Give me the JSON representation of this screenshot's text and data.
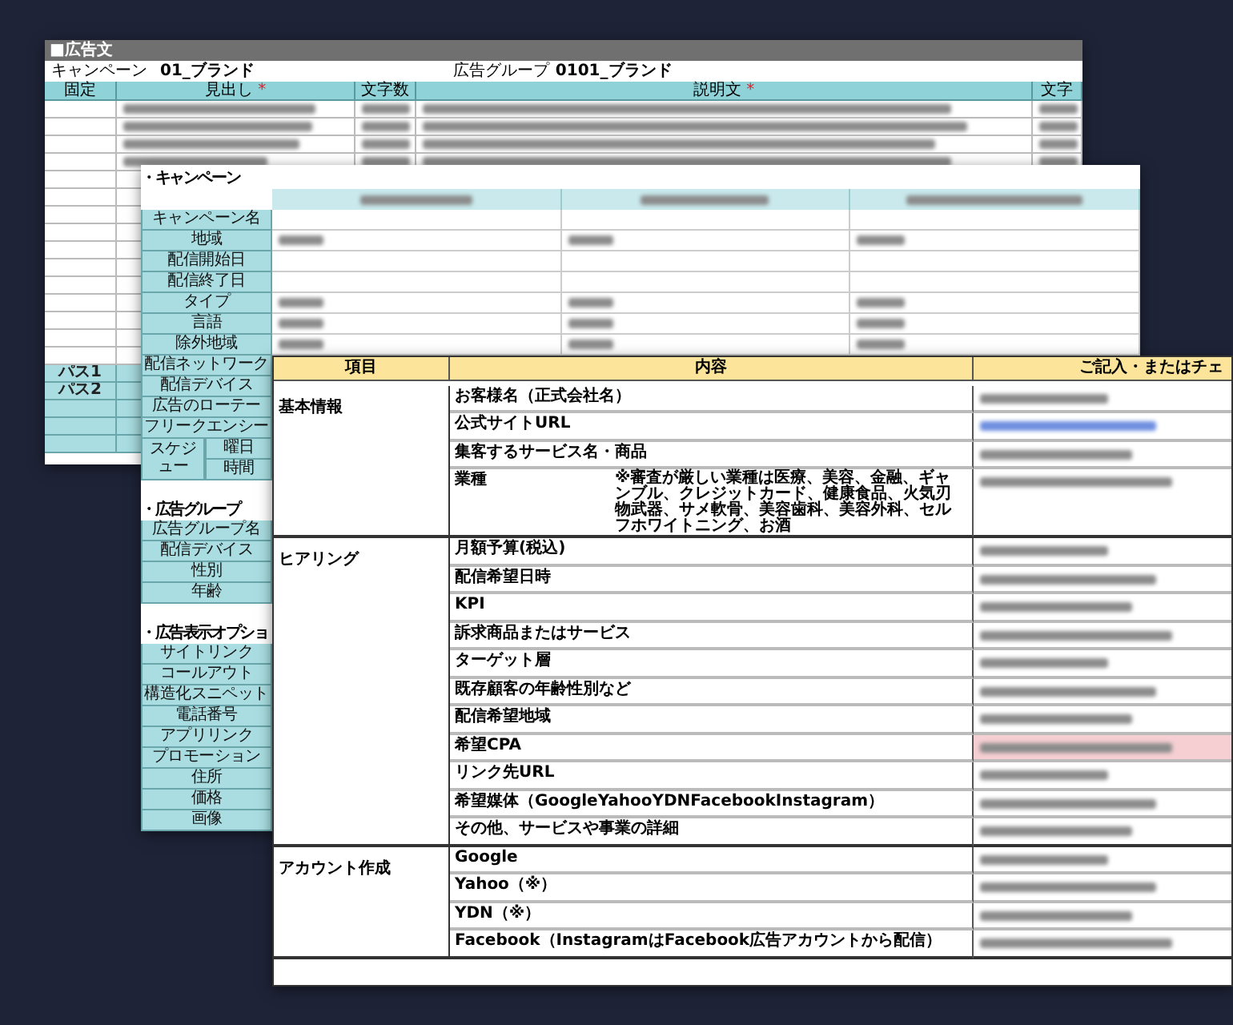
{
  "ad_sheet": {
    "title": "■広告文",
    "campaign_label": "キャンペーン",
    "campaign": "01_ブランド",
    "group_label": "広告グループ",
    "group": "0101_ブランド",
    "required_mark": "*",
    "columns": [
      {
        "label": "固定",
        "required": false
      },
      {
        "label": "見出し",
        "required": true
      },
      {
        "label": "文字数",
        "required": false
      },
      {
        "label": "説明文",
        "required": true
      },
      {
        "label": "文字",
        "required": false
      }
    ],
    "path_rows": [
      "パス1",
      "パス2"
    ]
  },
  "settings_sheet": {
    "sections": [
      {
        "title": "・キャンペーン",
        "rows": [
          {
            "kind": "single",
            "label": "キャンペーン名"
          },
          {
            "kind": "single",
            "label": "地域"
          },
          {
            "kind": "single",
            "label": "配信開始日"
          },
          {
            "kind": "single",
            "label": "配信終了日"
          },
          {
            "kind": "single",
            "label": "タイプ"
          },
          {
            "kind": "single",
            "label": "言語"
          },
          {
            "kind": "single",
            "label": "除外地域"
          },
          {
            "kind": "single",
            "label": "配信ネットワーク"
          },
          {
            "kind": "single",
            "label": "配信デバイス"
          },
          {
            "kind": "single",
            "label": "広告のローテー"
          },
          {
            "kind": "single",
            "label": "フリークエンシー"
          },
          {
            "kind": "split",
            "label": "スケジュー",
            "parts": [
              "曜日",
              "時間"
            ]
          }
        ]
      },
      {
        "title": "・広告グループ",
        "rows": [
          {
            "kind": "single",
            "label": "広告グループ名"
          },
          {
            "kind": "single",
            "label": "配信デバイス"
          },
          {
            "kind": "single",
            "label": "性別"
          },
          {
            "kind": "single",
            "label": "年齢"
          }
        ]
      },
      {
        "title": "・広告表示オプショ",
        "rows": [
          {
            "kind": "single",
            "label": "サイトリンク"
          },
          {
            "kind": "single",
            "label": "コールアウト"
          },
          {
            "kind": "single",
            "label": "構造化スニペット"
          },
          {
            "kind": "single",
            "label": "電話番号"
          },
          {
            "kind": "single",
            "label": "アプリリンク"
          },
          {
            "kind": "single",
            "label": "プロモーション"
          },
          {
            "kind": "single",
            "label": "住所"
          },
          {
            "kind": "single",
            "label": "価格"
          },
          {
            "kind": "single",
            "label": "画像"
          }
        ]
      }
    ]
  },
  "answer_sheet": {
    "columns": [
      "項目",
      "内容",
      "ご記入・またはチェ"
    ],
    "groups": [
      {
        "label": "基本情報",
        "rows": [
          {
            "item": "お客様名（正式会社名）",
            "highlighted": false
          },
          {
            "item": "公式サイトURL",
            "highlighted": false
          },
          {
            "item": "集客するサービス名・商品",
            "highlighted": false
          },
          {
            "item": "業種",
            "note": "※審査が厳しい業種は医療、美容、金融、ギャンブル、クレジットカード、健康食品、火気刃物武器、サメ軟骨、美容歯科、美容外科、セルフホワイトニング、お酒",
            "highlighted": false
          }
        ]
      },
      {
        "label": "ヒアリング",
        "rows": [
          {
            "item": "月額予算(税込)",
            "highlighted": false
          },
          {
            "item": "配信希望日時",
            "highlighted": false
          },
          {
            "item": "KPI",
            "highlighted": false
          },
          {
            "item": "訴求商品またはサービス",
            "highlighted": false
          },
          {
            "item": "ターゲット層",
            "highlighted": false
          },
          {
            "item": "既存顧客の年齢性別など",
            "highlighted": false
          },
          {
            "item": "配信希望地域",
            "highlighted": false
          },
          {
            "item": "希望CPA",
            "highlighted": true
          },
          {
            "item": "リンク先URL",
            "highlighted": false
          },
          {
            "item": "希望媒体（GoogleYahooYDNFacebookInstagram）",
            "highlighted": false
          },
          {
            "item": "その他、サービスや事業の詳細",
            "highlighted": false
          }
        ]
      },
      {
        "label": "アカウント作成",
        "rows": [
          {
            "item": "Google",
            "highlighted": false
          },
          {
            "item": "Yahoo（※）",
            "highlighted": false
          },
          {
            "item": "YDN（※）",
            "highlighted": false
          },
          {
            "item": "Facebook（InstagramはFacebook広告アカウントから配信）",
            "highlighted": false
          }
        ]
      }
    ]
  }
}
